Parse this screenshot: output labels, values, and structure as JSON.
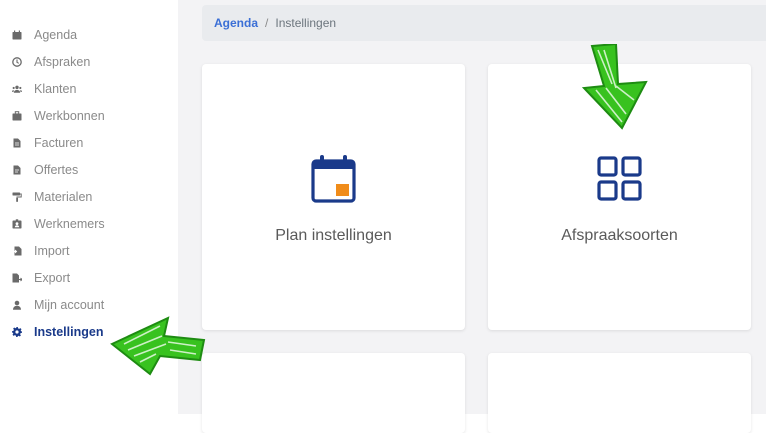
{
  "sidebar": {
    "items": [
      {
        "label": "Agenda",
        "icon": "calendar-icon"
      },
      {
        "label": "Afspraken",
        "icon": "clock-icon"
      },
      {
        "label": "Klanten",
        "icon": "users-icon"
      },
      {
        "label": "Werkbonnen",
        "icon": "briefcase-icon"
      },
      {
        "label": "Facturen",
        "icon": "invoice-icon"
      },
      {
        "label": "Offertes",
        "icon": "quote-icon"
      },
      {
        "label": "Materialen",
        "icon": "paint-roller-icon"
      },
      {
        "label": "Werknemers",
        "icon": "id-badge-icon"
      },
      {
        "label": "Import",
        "icon": "import-icon"
      },
      {
        "label": "Export",
        "icon": "export-icon"
      },
      {
        "label": "Mijn account",
        "icon": "user-icon"
      },
      {
        "label": "Instellingen",
        "icon": "gear-icon",
        "active": true
      }
    ]
  },
  "breadcrumb": {
    "root": "Agenda",
    "separator": "/",
    "current": "Instellingen"
  },
  "cards": [
    {
      "title": "Plan instellingen",
      "icon": "calendar-icon"
    },
    {
      "title": "Afspraaksoorten",
      "icon": "grid-icon"
    }
  ],
  "colors": {
    "accent": "#1a3a8a",
    "link": "#3b6fd6",
    "orange": "#f08c1a",
    "arrow": "#2ec11a"
  }
}
